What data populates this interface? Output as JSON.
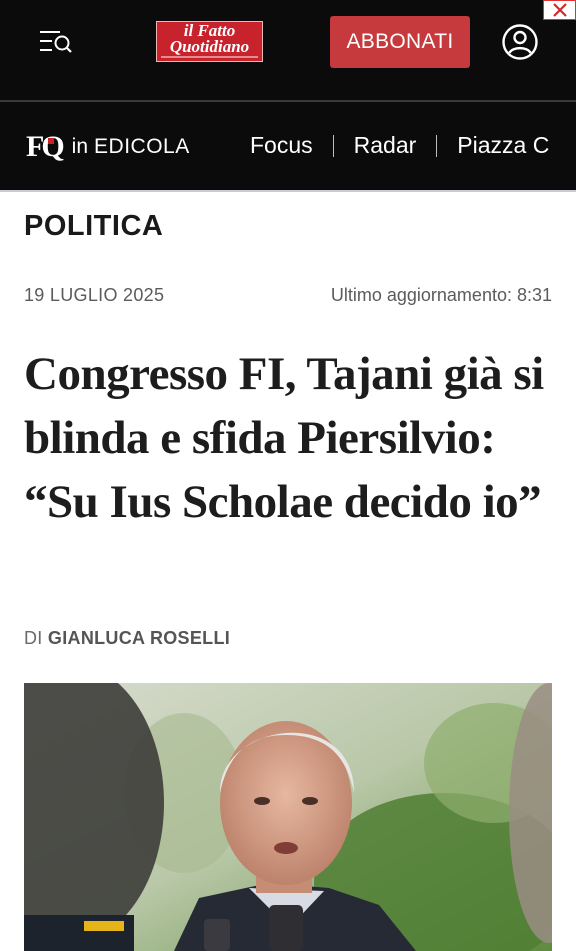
{
  "header": {
    "menu_icon": "menu-search-icon",
    "logo_text": "il Fatto Quotidiano",
    "subscribe_label": "ABBONATI",
    "user_icon": "user-icon",
    "close_icon": "close-icon",
    "colors": {
      "background": "#0b0b0b",
      "brand_red": "#c8232c",
      "button_red": "#c63a3d"
    }
  },
  "nav": {
    "edicola_logo": "FQ",
    "edicola_in": "in",
    "edicola_label": "EDICOLA",
    "links": [
      "Focus",
      "Radar",
      "Piazza C"
    ]
  },
  "article": {
    "section": "POLITICA",
    "date": "19 LUGLIO 2025",
    "updated": "Ultimo aggiornamento: 8:31",
    "headline": "Congresso FI, Tajani già si blinda e sfida Piersilvio: “Su Ius Scholae decido io”",
    "byline_prefix": "DI",
    "author": "GIANLUCA ROSELLI"
  }
}
